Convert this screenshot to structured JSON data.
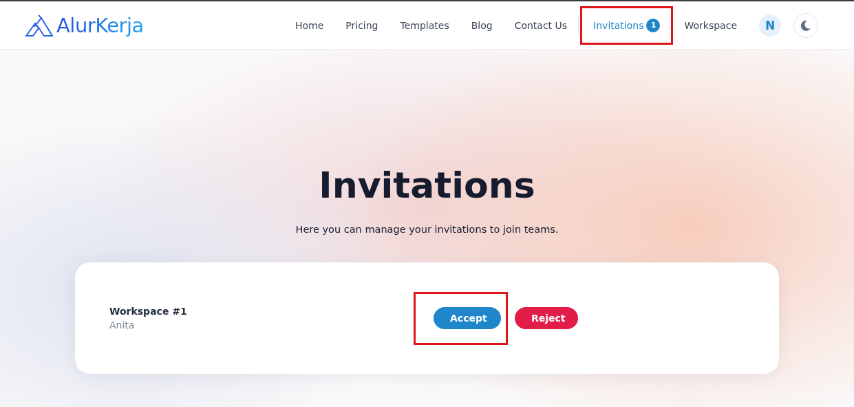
{
  "brand": {
    "name": "AlurKerja"
  },
  "nav": {
    "items": [
      {
        "label": "Home",
        "selected": false,
        "highlighted": false
      },
      {
        "label": "Pricing",
        "selected": false,
        "highlighted": false
      },
      {
        "label": "Templates",
        "selected": false,
        "highlighted": false
      },
      {
        "label": "Blog",
        "selected": false,
        "highlighted": false
      },
      {
        "label": "Contact Us",
        "selected": false,
        "highlighted": false
      },
      {
        "label": "Invitations",
        "selected": true,
        "highlighted": true,
        "badge": "1"
      },
      {
        "label": "Workspace",
        "selected": false,
        "highlighted": false
      }
    ],
    "avatar": "N"
  },
  "hero": {
    "title": "Invitations",
    "subtitle": "Here you can manage your invitations to join teams."
  },
  "invitations": [
    {
      "workspace": "Workspace #1",
      "inviter": "Anita",
      "buttons": [
        {
          "label": "Accept",
          "kind": "accept",
          "highlighted": true
        },
        {
          "label": "Reject",
          "kind": "reject",
          "highlighted": false
        }
      ]
    }
  ]
}
